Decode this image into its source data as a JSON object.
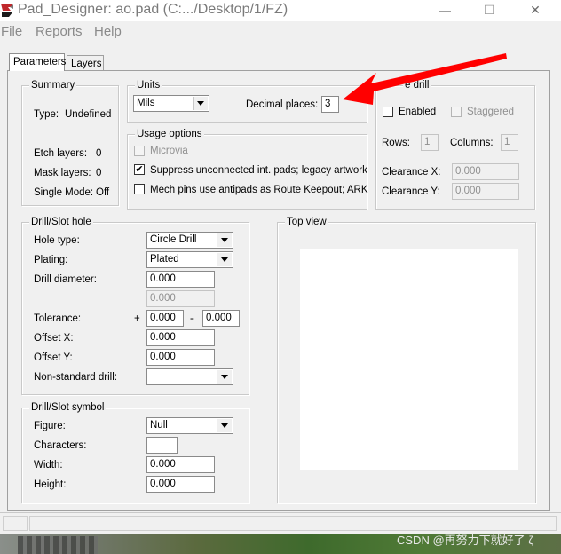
{
  "window": {
    "title": "Pad_Designer: ao.pad (C:.../Desktop/1/FZ)",
    "minimize_label": "—",
    "maximize_label": "☐",
    "close_label": "✕"
  },
  "menu": {
    "items": [
      "File",
      "Reports",
      "Help"
    ]
  },
  "tabs": [
    {
      "label": "Parameters",
      "active": true
    },
    {
      "label": "Layers",
      "active": false
    }
  ],
  "summary": {
    "title": "Summary",
    "type_label": "Type:",
    "type_value": "Undefined",
    "etch_label": "Etch layers:",
    "etch_value": "0",
    "mask_label": "Mask layers:",
    "mask_value": "0",
    "single_label": "Single Mode:",
    "single_value": "Off"
  },
  "units": {
    "title": "Units",
    "selected": "Mils",
    "decimal_label": "Decimal places:",
    "decimal_value": "3"
  },
  "usage": {
    "title": "Usage options",
    "microvia": {
      "label": "Microvia",
      "checked": false,
      "enabled": false
    },
    "suppress": {
      "label": "Suppress unconnected int. pads; legacy artwork",
      "checked": true
    },
    "mech": {
      "label": "Mech pins use antipads as Route Keepout; ARK",
      "checked": false
    }
  },
  "multi_drill": {
    "title_visible": "e drill",
    "enabled_label": "Enabled",
    "staggered_label": "Staggered",
    "rows_label": "Rows:",
    "rows_value": "1",
    "cols_label": "Columns:",
    "cols_value": "1",
    "clearx_label": "Clearance X:",
    "clearx_value": "0.000",
    "cleary_label": "Clearance Y:",
    "cleary_value": "0.000"
  },
  "drill_hole": {
    "title": "Drill/Slot hole",
    "hole_type_label": "Hole type:",
    "hole_type_value": "Circle Drill",
    "plating_label": "Plating:",
    "plating_value": "Plated",
    "diameter_label": "Drill diameter:",
    "diameter_value": "0.000",
    "diameter2_value": "0.000",
    "tolerance_label": "Tolerance:",
    "plus": "+",
    "minus": "-",
    "tol_plus_value": "0.000",
    "tol_minus_value": "0.000",
    "offx_label": "Offset X:",
    "offx_value": "0.000",
    "offy_label": "Offset Y:",
    "offy_value": "0.000",
    "nonstd_label": "Non-standard drill:",
    "nonstd_value": ""
  },
  "drill_symbol": {
    "title": "Drill/Slot symbol",
    "figure_label": "Figure:",
    "figure_value": "Null",
    "chars_label": "Characters:",
    "chars_value": "",
    "width_label": "Width:",
    "width_value": "0.000",
    "height_label": "Height:",
    "height_value": "0.000"
  },
  "top_view": {
    "title": "Top view"
  },
  "watermark": "CSDN @再努力下就好了 ζ",
  "colors": {
    "annotation_arrow": "#ff0000",
    "window_bg": "#f0f0f0"
  }
}
